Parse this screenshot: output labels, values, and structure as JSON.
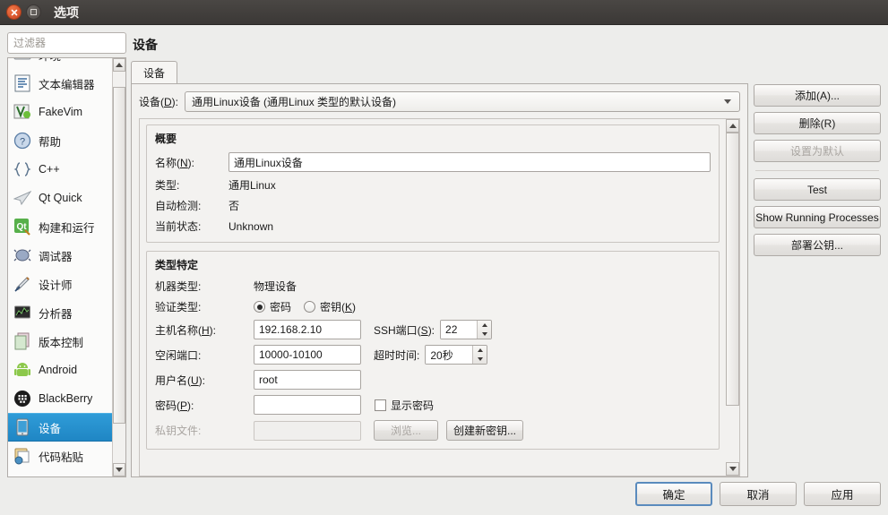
{
  "window": {
    "title": "选项",
    "close_icon": "close-icon",
    "maximize_icon": "maximize-icon"
  },
  "sidebar": {
    "filter_placeholder": "过滤器",
    "filter_value": "",
    "items": [
      {
        "label": "环境",
        "icon": "environment-icon",
        "selected": false
      },
      {
        "label": "文本编辑器",
        "icon": "text-editor-icon",
        "selected": false
      },
      {
        "label": "FakeVim",
        "icon": "fakevim-icon",
        "selected": false
      },
      {
        "label": "帮助",
        "icon": "help-icon",
        "selected": false
      },
      {
        "label": "C++",
        "icon": "cpp-icon",
        "selected": false
      },
      {
        "label": "Qt Quick",
        "icon": "qt-quick-icon",
        "selected": false
      },
      {
        "label": "构建和运行",
        "icon": "build-and-run-icon",
        "selected": false
      },
      {
        "label": "调试器",
        "icon": "debugger-icon",
        "selected": false
      },
      {
        "label": "设计师",
        "icon": "designer-icon",
        "selected": false
      },
      {
        "label": "分析器",
        "icon": "analyzer-icon",
        "selected": false
      },
      {
        "label": "版本控制",
        "icon": "version-control-icon",
        "selected": false
      },
      {
        "label": "Android",
        "icon": "android-icon",
        "selected": false
      },
      {
        "label": "BlackBerry",
        "icon": "blackberry-icon",
        "selected": false
      },
      {
        "label": "设备",
        "icon": "devices-icon",
        "selected": true
      },
      {
        "label": "代码粘贴",
        "icon": "code-paste-icon",
        "selected": false
      }
    ]
  },
  "main": {
    "page_title": "设备",
    "tabs": [
      {
        "label": "设备",
        "active": true
      }
    ],
    "device_selector": {
      "label_prefix": "设备(",
      "label_mnemonic": "D",
      "label_suffix": "):",
      "value": "通用Linux设备 (通用Linux 类型的默认设备)"
    },
    "overview": {
      "title": "概要",
      "name_label_prefix": "名称(",
      "name_label_mnemonic": "N",
      "name_label_suffix": "):",
      "name_value": "通用Linux设备",
      "rows": [
        {
          "label": "类型:",
          "value": "通用Linux"
        },
        {
          "label": "自动检测:",
          "value": "否"
        },
        {
          "label": "当前状态:",
          "value": "Unknown"
        }
      ]
    },
    "type_specific": {
      "title": "类型特定",
      "machine_type_label": "机器类型:",
      "machine_type_value": "物理设备",
      "auth_type_label": "验证类型:",
      "auth_password_label": "密码",
      "auth_password_checked": true,
      "auth_key_label_prefix": "密钥(",
      "auth_key_mnemonic": "K",
      "auth_key_label_suffix": ")",
      "auth_key_checked": false,
      "host_label_prefix": "主机名称(",
      "host_mnemonic": "H",
      "host_label_suffix": "):",
      "host_value": "192.168.2.10",
      "ssh_port_label_prefix": "SSH端口(",
      "ssh_port_mnemonic": "S",
      "ssh_port_label_suffix": "):",
      "ssh_port_value": "22",
      "free_ports_label": "空闲端口:",
      "free_ports_value": "10000-10100",
      "timeout_label": "超时时间:",
      "timeout_value": "20秒",
      "username_label_prefix": "用户名(",
      "username_mnemonic": "U",
      "username_label_suffix": "):",
      "username_value": "root",
      "password_label_prefix": "密码(",
      "password_mnemonic": "P",
      "password_label_suffix": "):",
      "password_value": "",
      "show_password_label": "显示密码",
      "show_password_checked": false,
      "private_key_label": "私钥文件:",
      "private_key_value": "",
      "browse_label": "浏览...",
      "create_key_label": "创建新密钥..."
    }
  },
  "side_buttons": [
    {
      "label": "添加(A)...",
      "disabled": false,
      "name": "add-button"
    },
    {
      "label": "删除(R)",
      "disabled": false,
      "name": "remove-button"
    },
    {
      "label": "设置为默认",
      "disabled": true,
      "name": "set-as-default-button"
    },
    {
      "label": "Test",
      "disabled": false,
      "name": "test-button"
    },
    {
      "label": "Show Running Processes",
      "disabled": false,
      "name": "show-running-processes-button"
    },
    {
      "label": "部署公钥...",
      "disabled": false,
      "name": "deploy-public-key-button"
    }
  ],
  "dialog_buttons": [
    {
      "label": "确定",
      "default": true,
      "name": "ok-button"
    },
    {
      "label": "取消",
      "default": false,
      "name": "cancel-button"
    },
    {
      "label": "应用",
      "default": false,
      "name": "apply-button"
    }
  ],
  "colors": {
    "selection_blue": "#2f9cd8",
    "titlebar": "#3b3836",
    "dialog_bg": "#ededeb",
    "close_button": "#d4502a"
  }
}
